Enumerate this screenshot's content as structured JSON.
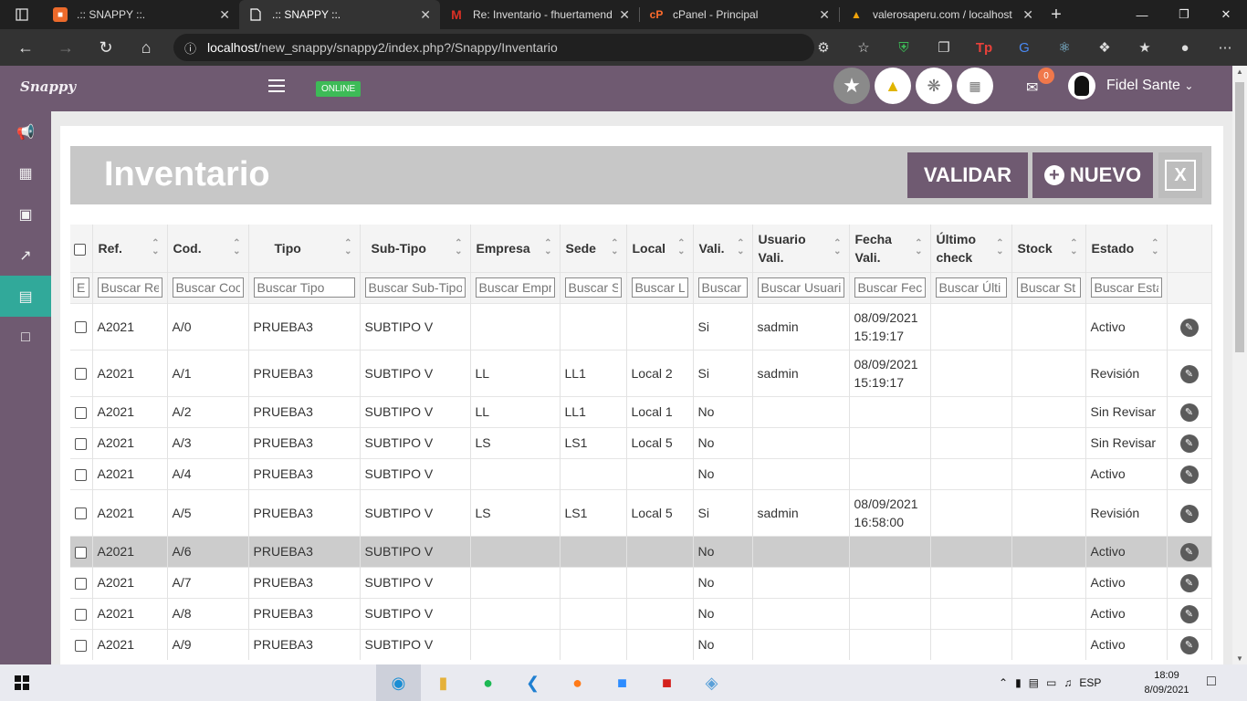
{
  "browser": {
    "tabs": [
      {
        "title": ".:: SNAPPY ::.",
        "favicon": "snappy-favicon",
        "color": "#ec6a2b",
        "active": false
      },
      {
        "title": ".:: SNAPPY ::.",
        "favicon": "page-icon",
        "color": "#333333",
        "active": true
      },
      {
        "title": "Re: Inventario - fhuertamendo",
        "favicon": "gmail-icon",
        "color": "#d93025",
        "active": false
      },
      {
        "title": "cPanel - Principal",
        "favicon": "cpanel-icon",
        "color": "#ff6c2c",
        "active": false
      },
      {
        "title": "valerosaperu.com / localhost",
        "favicon": "phpmyadmin-icon",
        "color": "#f0a30a",
        "active": false
      }
    ],
    "url_host": "localhost",
    "url_path": "/new_snappy/snappy2/index.php?/Snappy/Inventario"
  },
  "app": {
    "brand": "Snappy",
    "status_badge": "ONLINE",
    "notifications_count": "0",
    "user_name": "Fidel Sante",
    "sidebar_items": [
      "megaphone-icon",
      "calendar-icon",
      "cart-icon",
      "chart-icon",
      "clipboard-icon",
      "chat-icon"
    ],
    "active_sidebar": "clipboard-icon",
    "page_title": "Inventario",
    "validar_label": "VALIDAR",
    "nuevo_label": "NUEVO",
    "excel_label": "X"
  },
  "table": {
    "headers": [
      "Ref.",
      "Cod.",
      "Tipo",
      "Sub-Tipo",
      "Empresa",
      "Sede",
      "Local",
      "Vali.",
      "Usuario Vali.",
      "Fecha Vali.",
      "Último check",
      "Stock",
      "Estado"
    ],
    "placeholders": [
      "Buscar Re",
      "Buscar Coc",
      "Buscar Tipo",
      "Buscar Sub-Tipo",
      "Buscar Empr",
      "Buscar S",
      "Buscar L",
      "Buscar",
      "Buscar Usuari",
      "Buscar Fec",
      "Buscar Últi",
      "Buscar St",
      "Buscar Esta"
    ],
    "first_placeholder": "E",
    "rows": [
      {
        "ref": "A2021",
        "cod": "A/0",
        "tipo": "PRUEBA3",
        "subtipo": "SUBTIPO V",
        "empresa": "",
        "sede": "",
        "local": "",
        "vali": "Si",
        "usuario": "sadmin",
        "fecha": "08/09/2021 15:19:17",
        "check": "",
        "stock": "",
        "estado": "Activo"
      },
      {
        "ref": "A2021",
        "cod": "A/1",
        "tipo": "PRUEBA3",
        "subtipo": "SUBTIPO V",
        "empresa": "LL",
        "sede": "LL1",
        "local": "Local 2",
        "vali": "Si",
        "usuario": "sadmin",
        "fecha": "08/09/2021 15:19:17",
        "check": "",
        "stock": "",
        "estado": "Revisión"
      },
      {
        "ref": "A2021",
        "cod": "A/2",
        "tipo": "PRUEBA3",
        "subtipo": "SUBTIPO V",
        "empresa": "LL",
        "sede": "LL1",
        "local": "Local 1",
        "vali": "No",
        "usuario": "",
        "fecha": "",
        "check": "",
        "stock": "",
        "estado": "Sin Revisar"
      },
      {
        "ref": "A2021",
        "cod": "A/3",
        "tipo": "PRUEBA3",
        "subtipo": "SUBTIPO V",
        "empresa": "LS",
        "sede": "LS1",
        "local": "Local 5",
        "vali": "No",
        "usuario": "",
        "fecha": "",
        "check": "",
        "stock": "",
        "estado": "Sin Revisar"
      },
      {
        "ref": "A2021",
        "cod": "A/4",
        "tipo": "PRUEBA3",
        "subtipo": "SUBTIPO V",
        "empresa": "",
        "sede": "",
        "local": "",
        "vali": "No",
        "usuario": "",
        "fecha": "",
        "check": "",
        "stock": "",
        "estado": "Activo"
      },
      {
        "ref": "A2021",
        "cod": "A/5",
        "tipo": "PRUEBA3",
        "subtipo": "SUBTIPO V",
        "empresa": "LS",
        "sede": "LS1",
        "local": "Local 5",
        "vali": "Si",
        "usuario": "sadmin",
        "fecha": "08/09/2021 16:58:00",
        "check": "",
        "stock": "",
        "estado": "Revisión"
      },
      {
        "ref": "A2021",
        "cod": "A/6",
        "tipo": "PRUEBA3",
        "subtipo": "SUBTIPO V",
        "empresa": "",
        "sede": "",
        "local": "",
        "vali": "No",
        "usuario": "",
        "fecha": "",
        "check": "",
        "stock": "",
        "estado": "Activo"
      },
      {
        "ref": "A2021",
        "cod": "A/7",
        "tipo": "PRUEBA3",
        "subtipo": "SUBTIPO V",
        "empresa": "",
        "sede": "",
        "local": "",
        "vali": "No",
        "usuario": "",
        "fecha": "",
        "check": "",
        "stock": "",
        "estado": "Activo"
      },
      {
        "ref": "A2021",
        "cod": "A/8",
        "tipo": "PRUEBA3",
        "subtipo": "SUBTIPO V",
        "empresa": "",
        "sede": "",
        "local": "",
        "vali": "No",
        "usuario": "",
        "fecha": "",
        "check": "",
        "stock": "",
        "estado": "Activo"
      },
      {
        "ref": "A2021",
        "cod": "A/9",
        "tipo": "PRUEBA3",
        "subtipo": "SUBTIPO V",
        "empresa": "",
        "sede": "",
        "local": "",
        "vali": "No",
        "usuario": "",
        "fecha": "",
        "check": "",
        "stock": "",
        "estado": "Activo"
      }
    ],
    "selected_row": "A/6"
  },
  "taskbar": {
    "apps": [
      "edge-icon",
      "file-explorer-icon",
      "spotify-icon",
      "vscode-icon",
      "firefox-icon",
      "zoom-icon",
      "acrobat-icon",
      "paint-icon"
    ],
    "language": "ESP",
    "time": "18:09",
    "date": "8/09/2021"
  },
  "colors": {
    "brand": "#6f5a71",
    "accent": "#31a99a",
    "online": "#3dbb57"
  }
}
